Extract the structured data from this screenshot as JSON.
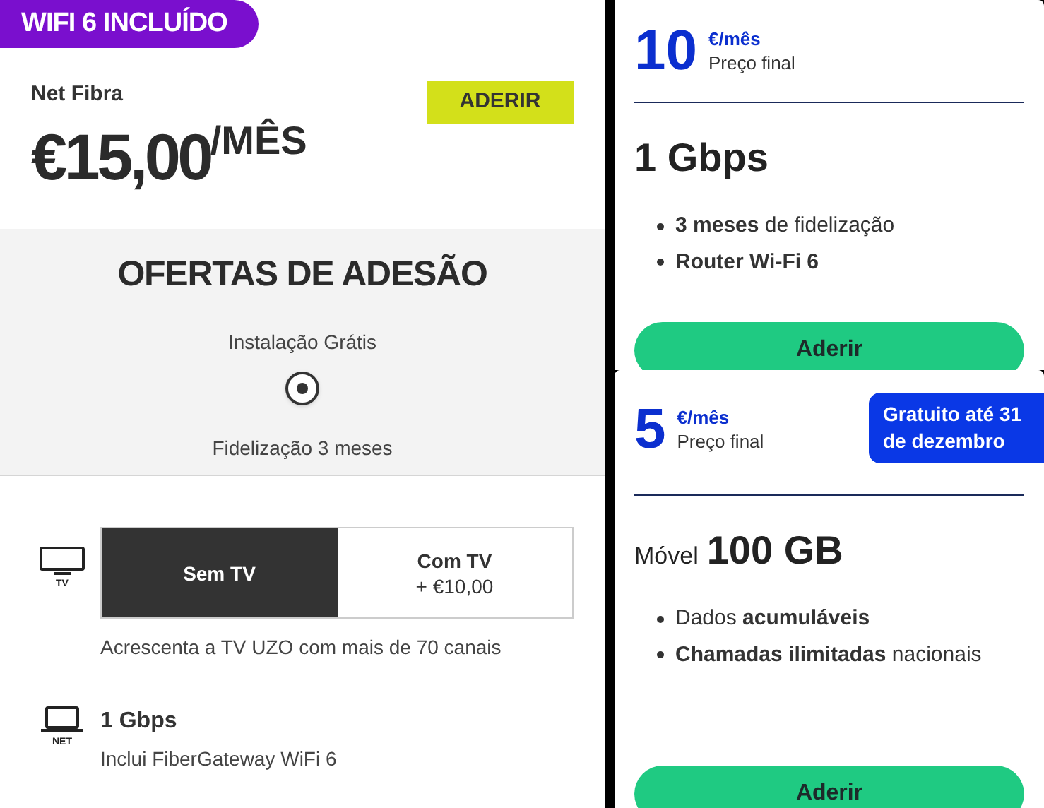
{
  "plan": {
    "badge": "WIFI 6 INCLUÍDO",
    "name": "Net Fibra",
    "price": "€15,00",
    "price_unit": "/MÊS",
    "button": "ADERIR"
  },
  "offers": {
    "title": "OFERTAS DE ADESÃO",
    "options": [
      {
        "label": "Instalação Grátis",
        "selected": true
      }
    ],
    "note": "Fidelização 3 meses"
  },
  "tv": {
    "icon_label": "TV",
    "options": [
      {
        "label": "Sem TV",
        "selected": true
      },
      {
        "label": "Com TV",
        "extra": "+ €10,00",
        "selected": false
      }
    ],
    "description": "Acrescenta a TV UZO com mais de 70 canais"
  },
  "net": {
    "icon_label": "NET",
    "speed": "1 Gbps",
    "description": "Inclui FiberGateway WiFi 6"
  },
  "cards": [
    {
      "price": "10",
      "unit": "€/mês",
      "price_note": "Preço final",
      "heading": "1 Gbps",
      "features": [
        "**3 meses** de fidelização",
        "**Router Wi-Fi 6**"
      ],
      "button": "Aderir"
    },
    {
      "price": "5",
      "unit": "€/mês",
      "price_note": "Preço final",
      "badge": "Gratuito até 31 de dezembro",
      "heading_prefix": "Móvel",
      "heading": "100 GB",
      "features": [
        "Dados **acumuláveis**",
        "**Chamadas ilimitadas** nacionais"
      ],
      "button": "Aderir"
    }
  ]
}
